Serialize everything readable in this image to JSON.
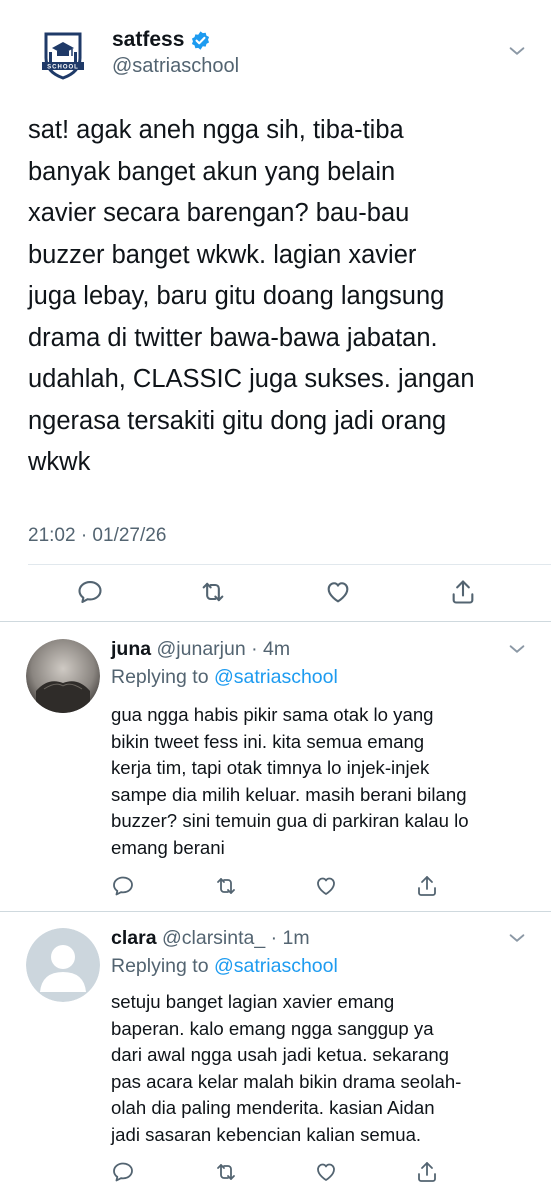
{
  "main_tweet": {
    "display_name": "satfess",
    "handle": "@satriaschool",
    "avatar_badge_text": "SCHOOL",
    "text": "sat! agak aneh ngga sih, tiba-tiba\nbanyak banget akun yang belain\nxavier secara barengan? bau-bau\nbuzzer banget wkwk. lagian xavier\njuga lebay, baru gitu doang langsung\ndrama di twitter bawa-bawa jabatan.\nudahlah, CLASSIC juga sukses. jangan\nngerasa tersakiti gitu dong jadi orang\nwkwk",
    "timestamp": "21:02 · 01/27/26",
    "icons": [
      "reply-icon",
      "retweet-icon",
      "like-icon",
      "share-icon"
    ]
  },
  "replies": [
    {
      "display_name": "juna",
      "handle_time": "@junarjun · 4m",
      "replying_prefix": "Replying to",
      "replying_to": "@satriaschool",
      "text": "gua ngga habis pikir sama otak lo yang\nbikin tweet fess ini. kita semua emang\nkerja tim, tapi otak timnya lo injek-injek\nsampe dia milih keluar. masih berani bilang\nbuzzer? sini temuin gua di parkiran kalau lo\nemang berani"
    },
    {
      "display_name": "clara",
      "handle_time": "@clarsinta_ · 1m",
      "replying_prefix": "Replying to",
      "replying_to": "@satriaschool",
      "text": "setuju banget lagian xavier emang\nbaperan. kalo emang ngga sanggup ya\ndari awal ngga usah jadi ketua. sekarang\npas acara kelar malah bikin drama seolah-\nolah dia paling menderita. kasian Aidan\njadi sasaran kebencian kalian semua."
    }
  ],
  "colors": {
    "text": "#0f1419",
    "secondary": "#536471",
    "accent": "#1d9bf0",
    "divider": "#cfd9de",
    "logo_navy": "#1f3a68"
  }
}
